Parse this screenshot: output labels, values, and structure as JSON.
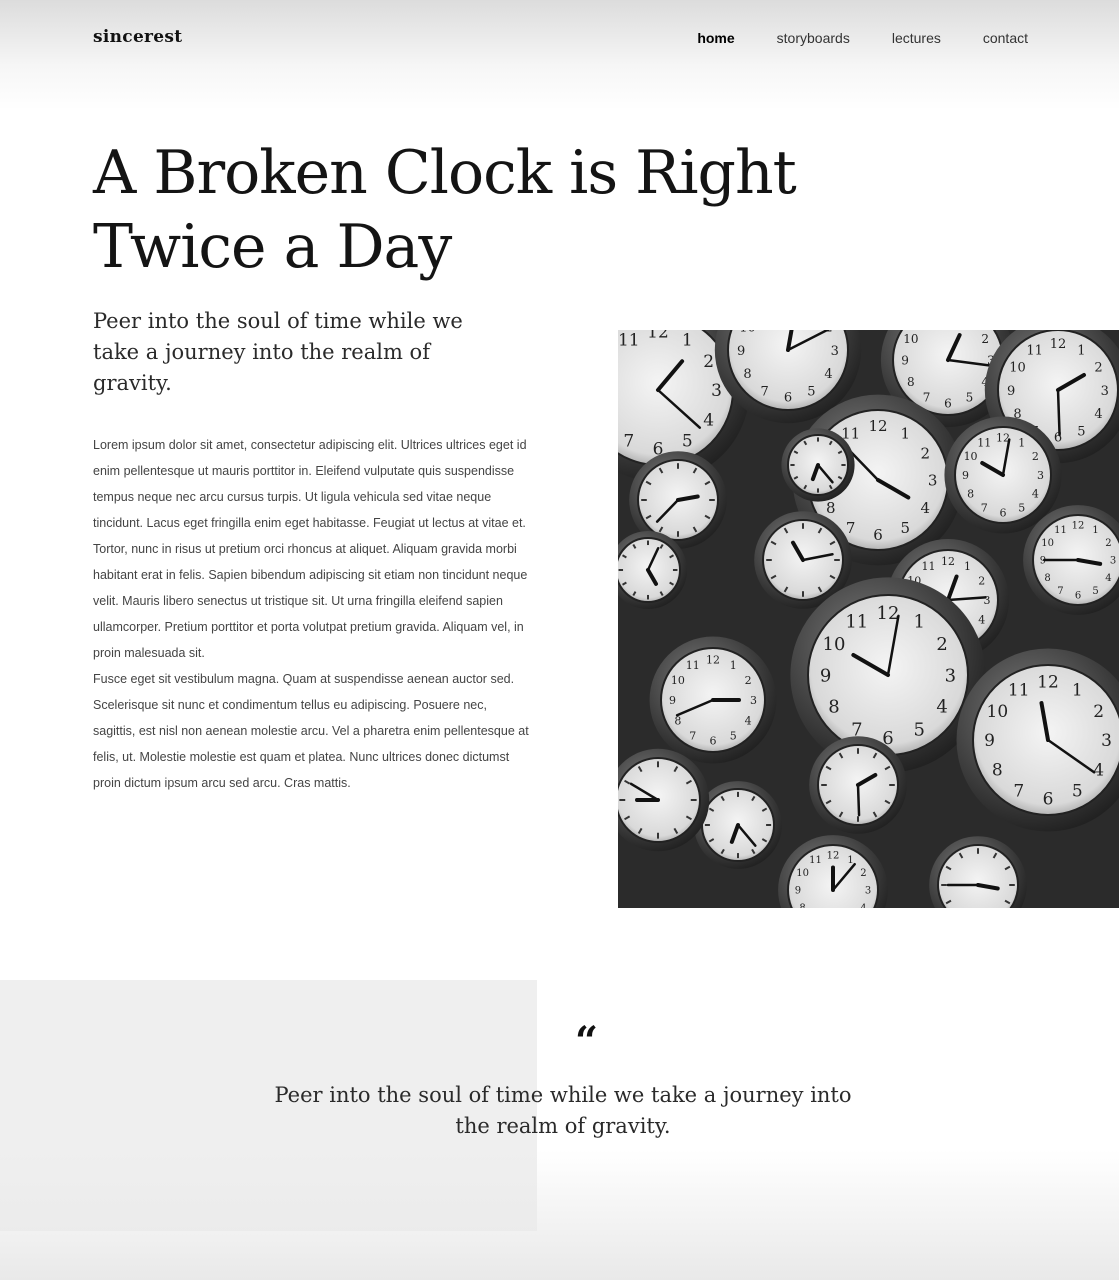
{
  "brand": "sincerest",
  "nav": {
    "items": [
      "home",
      "storyboards",
      "lectures",
      "contact"
    ]
  },
  "hero": {
    "title_line1": "A Broken Clock is Right",
    "title_line2": "Twice a Day",
    "lede": "Peer into the soul of time while we take a journey into the realm of gravity."
  },
  "body": {
    "paragraph1": "Lorem ipsum dolor sit amet, consectetur adipiscing elit. Ultrices ultrices eget id enim pellentesque ut mauris porttitor in. Eleifend vulputate quis suspendisse tempus neque nec arcu cursus turpis. Ut ligula vehicula sed vitae neque tincidunt. Lacus eget fringilla enim eget habitasse. Feugiat ut lectus at vitae et. Tortor, nunc in risus ut pretium orci rhoncus at aliquet. Aliquam gravida morbi habitant erat in felis. Sapien bibendum adipiscing sit etiam non tincidunt neque velit. Mauris libero senectus ut tristique sit. Ut urna fringilla eleifend sapien ullamcorper. Pretium porttitor et porta volutpat pretium gravida. Aliquam vel, in proin malesuada sit.",
    "paragraph2": "Fusce eget sit vestibulum magna. Quam at suspendisse aenean auctor sed. Scelerisque sit nunc et condimentum tellus eu adipiscing. Posuere nec, sagittis, est nisl non aenean molestie arcu. Vel a pharetra enim pellentesque at felis, ut. Molestie molestie est quam et platea. Nunc ultrices donec dictumst proin dictum ipsum arcu sed arcu. Cras mattis."
  },
  "photo": {
    "icon": "clocks-photo",
    "clock_numerals": [
      "12",
      "1",
      "2",
      "3",
      "4",
      "5",
      "6",
      "7",
      "8",
      "9",
      "10",
      "11"
    ]
  },
  "quote": {
    "mark": "“",
    "text": "Peer into the soul of time while we take a journey into the realm of gravity."
  }
}
